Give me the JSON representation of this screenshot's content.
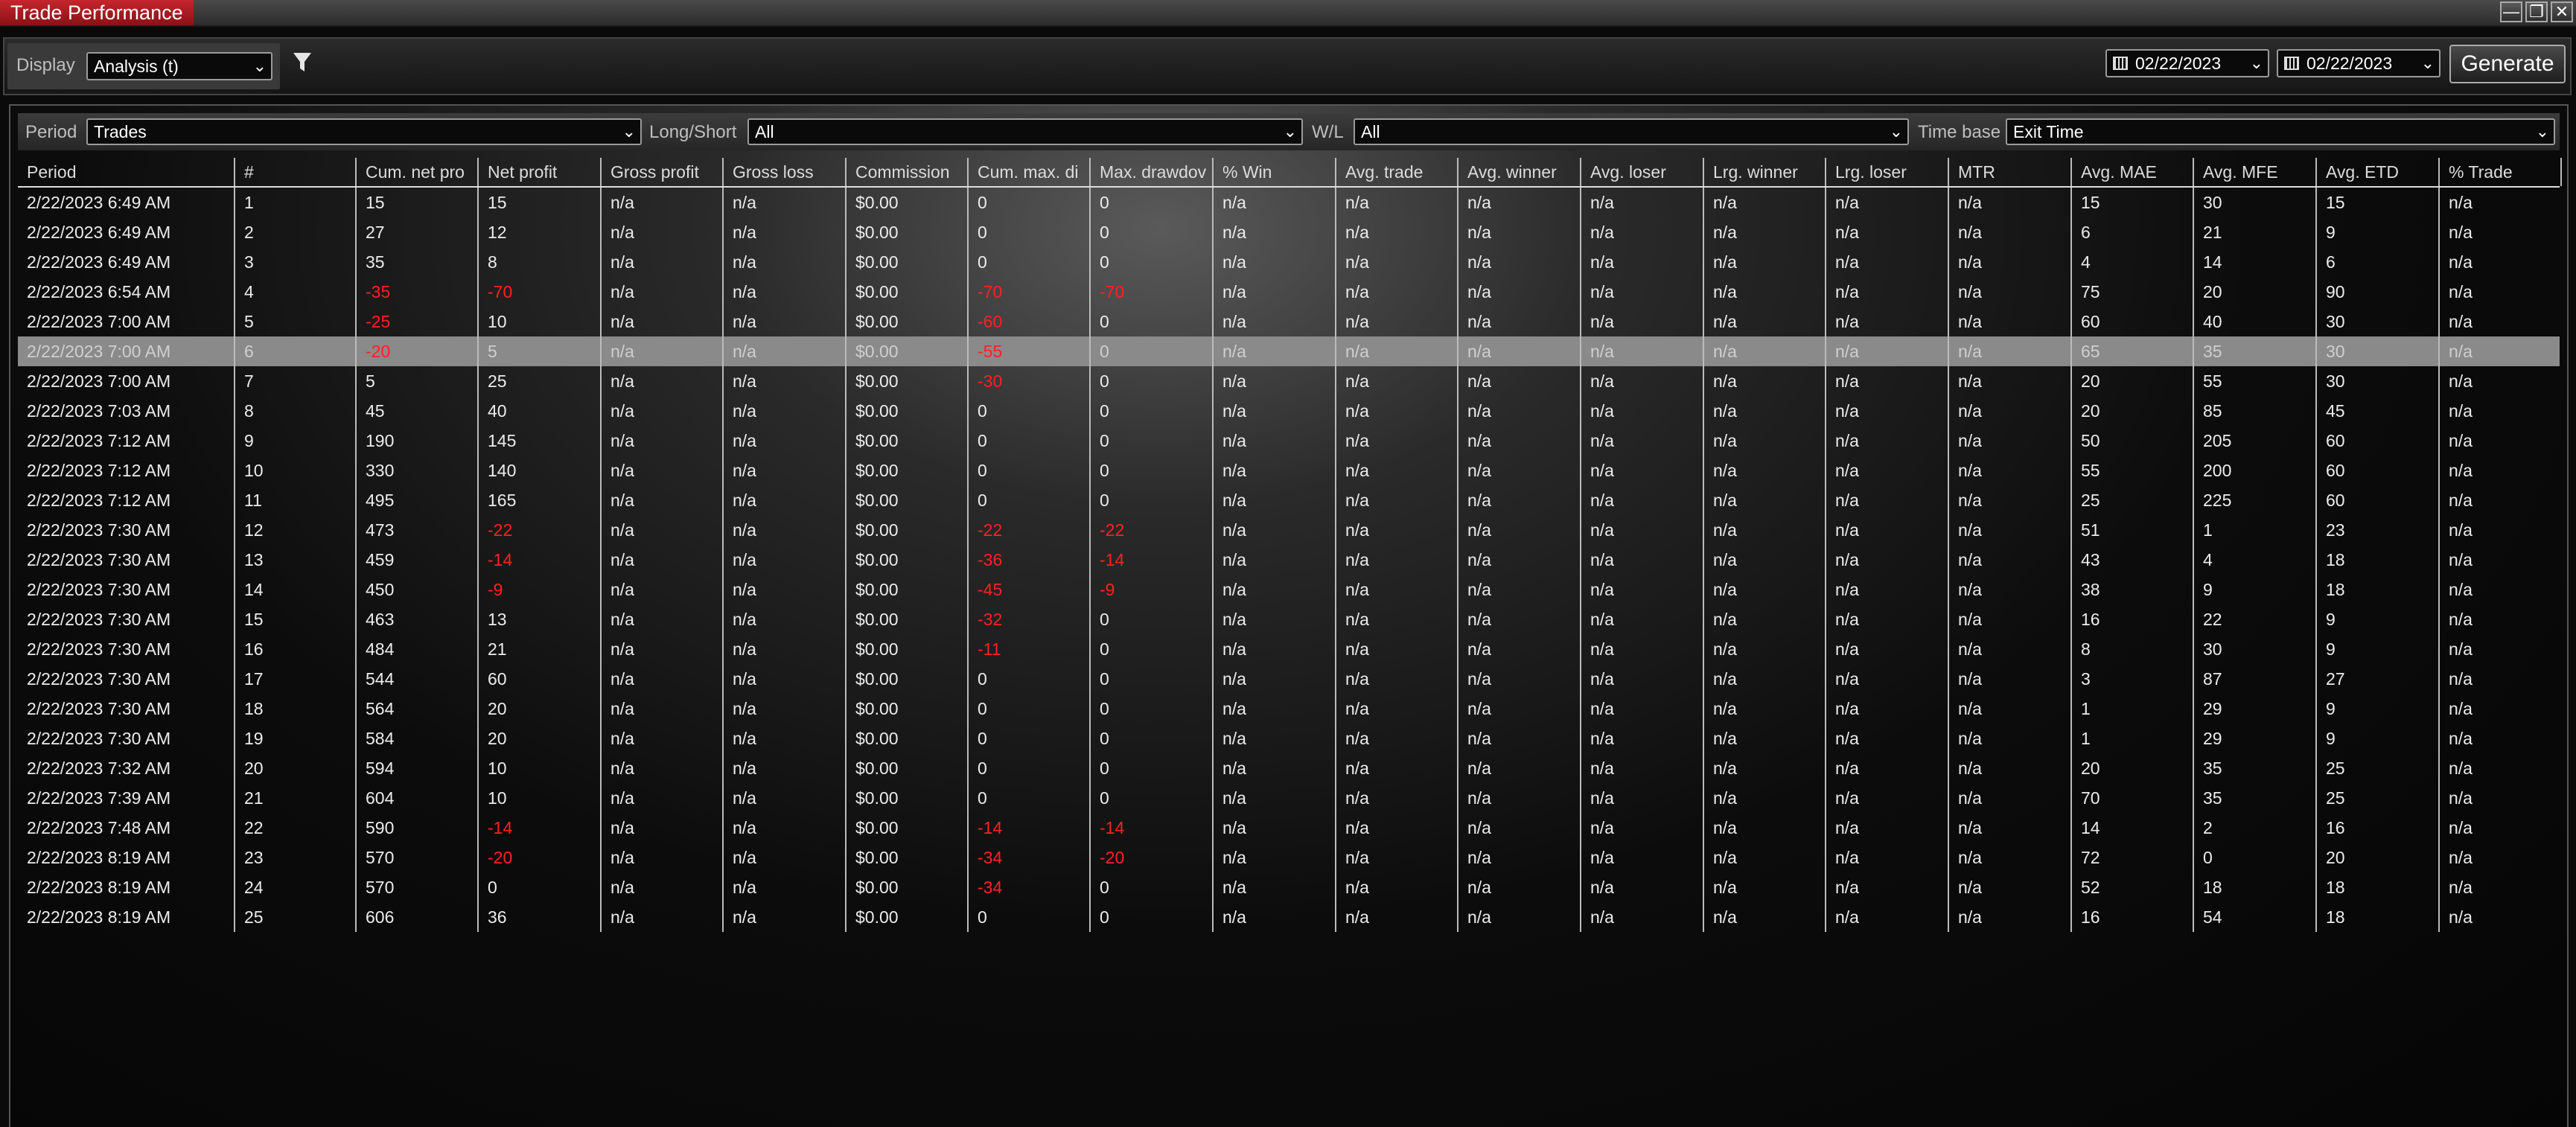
{
  "window": {
    "title": "Trade Performance",
    "min": "—",
    "max": "❐",
    "close": "✕"
  },
  "toolbar": {
    "display_label": "Display",
    "display_value": "Analysis (t)",
    "date_from": "02/22/2023",
    "date_to": "02/22/2023",
    "generate_label": "Generate"
  },
  "filters": {
    "period_label": "Period",
    "period_value": "Trades",
    "longshort_label": "Long/Short",
    "longshort_value": "All",
    "wl_label": "W/L",
    "wl_value": "All",
    "timebase_label": "Time base",
    "timebase_value": "Exit Time"
  },
  "table": {
    "columns": [
      "Period",
      "#",
      "Cum. net pro",
      "Net profit",
      "Gross profit",
      "Gross loss",
      "Commission",
      "Cum. max. di",
      "Max. drawdov",
      "% Win",
      "Avg. trade",
      "Avg. winner",
      "Avg. loser",
      "Lrg. winner",
      "Lrg. loser",
      "MTR",
      "Avg. MAE",
      "Avg. MFE",
      "Avg. ETD",
      "% Trade"
    ],
    "selected_row": 5,
    "rows": [
      [
        "2/22/2023 6:49 AM",
        "1",
        "15",
        "15",
        "n/a",
        "n/a",
        "$0.00",
        "0",
        "0",
        "n/a",
        "n/a",
        "n/a",
        "n/a",
        "n/a",
        "n/a",
        "n/a",
        "15",
        "30",
        "15",
        "n/a"
      ],
      [
        "2/22/2023 6:49 AM",
        "2",
        "27",
        "12",
        "n/a",
        "n/a",
        "$0.00",
        "0",
        "0",
        "n/a",
        "n/a",
        "n/a",
        "n/a",
        "n/a",
        "n/a",
        "n/a",
        "6",
        "21",
        "9",
        "n/a"
      ],
      [
        "2/22/2023 6:49 AM",
        "3",
        "35",
        "8",
        "n/a",
        "n/a",
        "$0.00",
        "0",
        "0",
        "n/a",
        "n/a",
        "n/a",
        "n/a",
        "n/a",
        "n/a",
        "n/a",
        "4",
        "14",
        "6",
        "n/a"
      ],
      [
        "2/22/2023 6:54 AM",
        "4",
        "-35",
        "-70",
        "n/a",
        "n/a",
        "$0.00",
        "-70",
        "-70",
        "n/a",
        "n/a",
        "n/a",
        "n/a",
        "n/a",
        "n/a",
        "n/a",
        "75",
        "20",
        "90",
        "n/a"
      ],
      [
        "2/22/2023 7:00 AM",
        "5",
        "-25",
        "10",
        "n/a",
        "n/a",
        "$0.00",
        "-60",
        "0",
        "n/a",
        "n/a",
        "n/a",
        "n/a",
        "n/a",
        "n/a",
        "n/a",
        "60",
        "40",
        "30",
        "n/a"
      ],
      [
        "2/22/2023 7:00 AM",
        "6",
        "-20",
        "5",
        "n/a",
        "n/a",
        "$0.00",
        "-55",
        "0",
        "n/a",
        "n/a",
        "n/a",
        "n/a",
        "n/a",
        "n/a",
        "n/a",
        "65",
        "35",
        "30",
        "n/a"
      ],
      [
        "2/22/2023 7:00 AM",
        "7",
        "5",
        "25",
        "n/a",
        "n/a",
        "$0.00",
        "-30",
        "0",
        "n/a",
        "n/a",
        "n/a",
        "n/a",
        "n/a",
        "n/a",
        "n/a",
        "20",
        "55",
        "30",
        "n/a"
      ],
      [
        "2/22/2023 7:03 AM",
        "8",
        "45",
        "40",
        "n/a",
        "n/a",
        "$0.00",
        "0",
        "0",
        "n/a",
        "n/a",
        "n/a",
        "n/a",
        "n/a",
        "n/a",
        "n/a",
        "20",
        "85",
        "45",
        "n/a"
      ],
      [
        "2/22/2023 7:12 AM",
        "9",
        "190",
        "145",
        "n/a",
        "n/a",
        "$0.00",
        "0",
        "0",
        "n/a",
        "n/a",
        "n/a",
        "n/a",
        "n/a",
        "n/a",
        "n/a",
        "50",
        "205",
        "60",
        "n/a"
      ],
      [
        "2/22/2023 7:12 AM",
        "10",
        "330",
        "140",
        "n/a",
        "n/a",
        "$0.00",
        "0",
        "0",
        "n/a",
        "n/a",
        "n/a",
        "n/a",
        "n/a",
        "n/a",
        "n/a",
        "55",
        "200",
        "60",
        "n/a"
      ],
      [
        "2/22/2023 7:12 AM",
        "11",
        "495",
        "165",
        "n/a",
        "n/a",
        "$0.00",
        "0",
        "0",
        "n/a",
        "n/a",
        "n/a",
        "n/a",
        "n/a",
        "n/a",
        "n/a",
        "25",
        "225",
        "60",
        "n/a"
      ],
      [
        "2/22/2023 7:30 AM",
        "12",
        "473",
        "-22",
        "n/a",
        "n/a",
        "$0.00",
        "-22",
        "-22",
        "n/a",
        "n/a",
        "n/a",
        "n/a",
        "n/a",
        "n/a",
        "n/a",
        "51",
        "1",
        "23",
        "n/a"
      ],
      [
        "2/22/2023 7:30 AM",
        "13",
        "459",
        "-14",
        "n/a",
        "n/a",
        "$0.00",
        "-36",
        "-14",
        "n/a",
        "n/a",
        "n/a",
        "n/a",
        "n/a",
        "n/a",
        "n/a",
        "43",
        "4",
        "18",
        "n/a"
      ],
      [
        "2/22/2023 7:30 AM",
        "14",
        "450",
        "-9",
        "n/a",
        "n/a",
        "$0.00",
        "-45",
        "-9",
        "n/a",
        "n/a",
        "n/a",
        "n/a",
        "n/a",
        "n/a",
        "n/a",
        "38",
        "9",
        "18",
        "n/a"
      ],
      [
        "2/22/2023 7:30 AM",
        "15",
        "463",
        "13",
        "n/a",
        "n/a",
        "$0.00",
        "-32",
        "0",
        "n/a",
        "n/a",
        "n/a",
        "n/a",
        "n/a",
        "n/a",
        "n/a",
        "16",
        "22",
        "9",
        "n/a"
      ],
      [
        "2/22/2023 7:30 AM",
        "16",
        "484",
        "21",
        "n/a",
        "n/a",
        "$0.00",
        "-11",
        "0",
        "n/a",
        "n/a",
        "n/a",
        "n/a",
        "n/a",
        "n/a",
        "n/a",
        "8",
        "30",
        "9",
        "n/a"
      ],
      [
        "2/22/2023 7:30 AM",
        "17",
        "544",
        "60",
        "n/a",
        "n/a",
        "$0.00",
        "0",
        "0",
        "n/a",
        "n/a",
        "n/a",
        "n/a",
        "n/a",
        "n/a",
        "n/a",
        "3",
        "87",
        "27",
        "n/a"
      ],
      [
        "2/22/2023 7:30 AM",
        "18",
        "564",
        "20",
        "n/a",
        "n/a",
        "$0.00",
        "0",
        "0",
        "n/a",
        "n/a",
        "n/a",
        "n/a",
        "n/a",
        "n/a",
        "n/a",
        "1",
        "29",
        "9",
        "n/a"
      ],
      [
        "2/22/2023 7:30 AM",
        "19",
        "584",
        "20",
        "n/a",
        "n/a",
        "$0.00",
        "0",
        "0",
        "n/a",
        "n/a",
        "n/a",
        "n/a",
        "n/a",
        "n/a",
        "n/a",
        "1",
        "29",
        "9",
        "n/a"
      ],
      [
        "2/22/2023 7:32 AM",
        "20",
        "594",
        "10",
        "n/a",
        "n/a",
        "$0.00",
        "0",
        "0",
        "n/a",
        "n/a",
        "n/a",
        "n/a",
        "n/a",
        "n/a",
        "n/a",
        "20",
        "35",
        "25",
        "n/a"
      ],
      [
        "2/22/2023 7:39 AM",
        "21",
        "604",
        "10",
        "n/a",
        "n/a",
        "$0.00",
        "0",
        "0",
        "n/a",
        "n/a",
        "n/a",
        "n/a",
        "n/a",
        "n/a",
        "n/a",
        "70",
        "35",
        "25",
        "n/a"
      ],
      [
        "2/22/2023 7:48 AM",
        "22",
        "590",
        "-14",
        "n/a",
        "n/a",
        "$0.00",
        "-14",
        "-14",
        "n/a",
        "n/a",
        "n/a",
        "n/a",
        "n/a",
        "n/a",
        "n/a",
        "14",
        "2",
        "16",
        "n/a"
      ],
      [
        "2/22/2023 8:19 AM",
        "23",
        "570",
        "-20",
        "n/a",
        "n/a",
        "$0.00",
        "-34",
        "-20",
        "n/a",
        "n/a",
        "n/a",
        "n/a",
        "n/a",
        "n/a",
        "n/a",
        "72",
        "0",
        "20",
        "n/a"
      ],
      [
        "2/22/2023 8:19 AM",
        "24",
        "570",
        "0",
        "n/a",
        "n/a",
        "$0.00",
        "-34",
        "0",
        "n/a",
        "n/a",
        "n/a",
        "n/a",
        "n/a",
        "n/a",
        "n/a",
        "52",
        "18",
        "18",
        "n/a"
      ],
      [
        "2/22/2023 8:19 AM",
        "25",
        "606",
        "36",
        "n/a",
        "n/a",
        "$0.00",
        "0",
        "0",
        "n/a",
        "n/a",
        "n/a",
        "n/a",
        "n/a",
        "n/a",
        "n/a",
        "16",
        "54",
        "18",
        "n/a"
      ]
    ]
  },
  "colors": {
    "negative": "#ff2020",
    "title_tab": "#b01c22",
    "selected_row": "#8a8a8a"
  },
  "icons": {
    "filter": "filter-icon",
    "calendar": "calendar-icon",
    "dropdown": "chevron-down-icon"
  }
}
